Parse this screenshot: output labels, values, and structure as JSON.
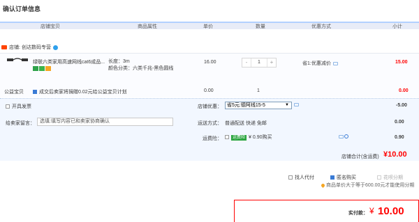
{
  "page_title": "确认订单信息",
  "columns": [
    "店铺宝贝",
    "商品属性",
    "单价",
    "数量",
    "优惠方式",
    "小计"
  ],
  "shop": {
    "label": "店铺:",
    "name": "创达数码专营"
  },
  "item": {
    "title": "绿联六类家用高速网线cat6成品...",
    "attr_length": "长度：3m",
    "attr_color": "颜色分类：六类千兆-黑色圆线",
    "price": "16.00",
    "quantity": "1",
    "qty_minus": "-",
    "qty_plus": "+",
    "discount": "省1:优惠减价",
    "subtotal": "15.00"
  },
  "charity": {
    "label": "公益宝贝",
    "text": "成交后卖家将捐赠0.02元给公益宝贝计划",
    "price": "0.00",
    "quantity": "1",
    "subtotal": "0.00"
  },
  "invoice_label": "开具发票",
  "message": {
    "label": "给卖家留言：",
    "placeholder": "选填:填写内容已和卖家协商确认"
  },
  "shop_discount": {
    "label": "店铺优惠：",
    "selected": "省5元:德阿线15-5",
    "amount": "-5.00"
  },
  "shipping": {
    "label": "运送方式：",
    "value": "普通配送 快递 免邮",
    "amount": "0.00"
  },
  "insurance": {
    "label": "运费险：",
    "tag": "运费险",
    "value": "¥ 0.90购买",
    "amount": "0.90"
  },
  "shop_total": {
    "label": "店铺合计(含运费)",
    "value": "¥10.00"
  },
  "pay_options": [
    "找人代付",
    "匿名购买",
    "花呗分期"
  ],
  "installment_note": "商品单价大于等于600.00元才能使用分期",
  "pay_total": {
    "label": "实付款：",
    "currency": "¥",
    "value": "10.00"
  },
  "colors": {
    "accent_red": "#ff0000",
    "header_bg": "#e8ecf7",
    "options_bg": "#f2f7ff",
    "link_blue": "#3a7bd5"
  }
}
